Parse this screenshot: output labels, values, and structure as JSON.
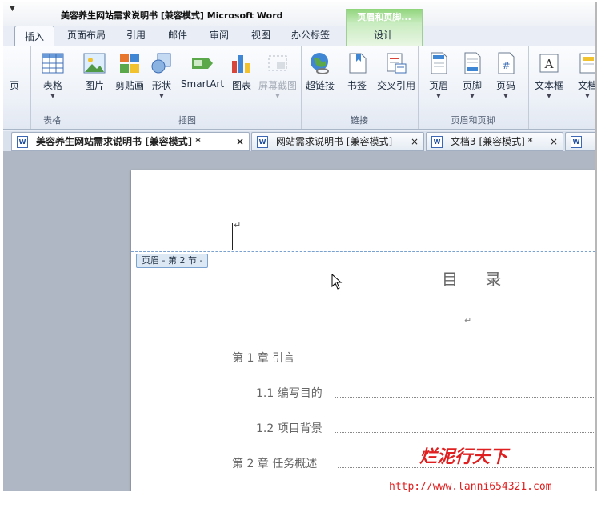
{
  "window": {
    "title": "美容养生网站需求说明书 [兼容模式] Microsoft Word",
    "context_group": "页眉和页脚...",
    "context_tab": "设计"
  },
  "tabs": [
    "插入",
    "页面布局",
    "引用",
    "邮件",
    "审阅",
    "视图",
    "办公标签"
  ],
  "active_tab": "插入",
  "ribbon": {
    "partial_left_label": "页",
    "groups": [
      {
        "label": "表格",
        "buttons": [
          {
            "label": "表格",
            "icon": "table-icon",
            "dropdown": true
          }
        ]
      },
      {
        "label": "插图",
        "buttons": [
          {
            "label": "图片",
            "icon": "picture-icon",
            "dropdown": false
          },
          {
            "label": "剪贴画",
            "icon": "clipart-icon",
            "dropdown": false
          },
          {
            "label": "形状",
            "icon": "shapes-icon",
            "dropdown": true
          },
          {
            "label": "SmartArt",
            "icon": "smartart-icon",
            "dropdown": false
          },
          {
            "label": "图表",
            "icon": "chart-icon",
            "dropdown": false
          },
          {
            "label": "屏幕截图",
            "icon": "screenshot-icon",
            "dropdown": true,
            "disabled": true
          }
        ]
      },
      {
        "label": "链接",
        "buttons": [
          {
            "label": "超链接",
            "icon": "globe-link-icon",
            "dropdown": false
          },
          {
            "label": "书签",
            "icon": "bookmark-icon",
            "dropdown": false
          },
          {
            "label": "交叉引用",
            "icon": "cross-reference-icon",
            "dropdown": false
          }
        ]
      },
      {
        "label": "页眉和页脚",
        "buttons": [
          {
            "label": "页眉",
            "icon": "header-icon",
            "dropdown": true
          },
          {
            "label": "页脚",
            "icon": "footer-icon",
            "dropdown": true
          },
          {
            "label": "页码",
            "icon": "page-number-icon",
            "dropdown": true
          }
        ]
      },
      {
        "label": "",
        "buttons": [
          {
            "label": "文本框",
            "icon": "textbox-icon",
            "dropdown": true
          },
          {
            "label": "文档",
            "icon": "document-part-icon",
            "dropdown": true
          }
        ]
      }
    ]
  },
  "doc_tabs": [
    {
      "title": "美容养生网站需求说明书 [兼容模式] *",
      "active": true,
      "close": "×"
    },
    {
      "title": "网站需求说明书 [兼容模式]",
      "active": false,
      "close": "×"
    },
    {
      "title": "文档3 [兼容模式] *",
      "active": false,
      "close": "×"
    }
  ],
  "document": {
    "header_tag": "页眉 - 第 2 节 -",
    "paragraph_mark": "↵",
    "toc_title": "目 录",
    "toc_entries": [
      {
        "text": "第 1 章  引言",
        "level": 1
      },
      {
        "text": "1.1 编写目的",
        "level": 2
      },
      {
        "text": "1.2 项目背景",
        "level": 2
      },
      {
        "text": "第 2 章  任务概述",
        "level": 1
      }
    ]
  },
  "watermark": {
    "name": "烂泥行天下",
    "url": "http://www.lanni654321.com"
  },
  "colors": {
    "accent": "#2b579a",
    "context_tab_green": "#8fd47a",
    "watermark_red": "#e02020"
  }
}
